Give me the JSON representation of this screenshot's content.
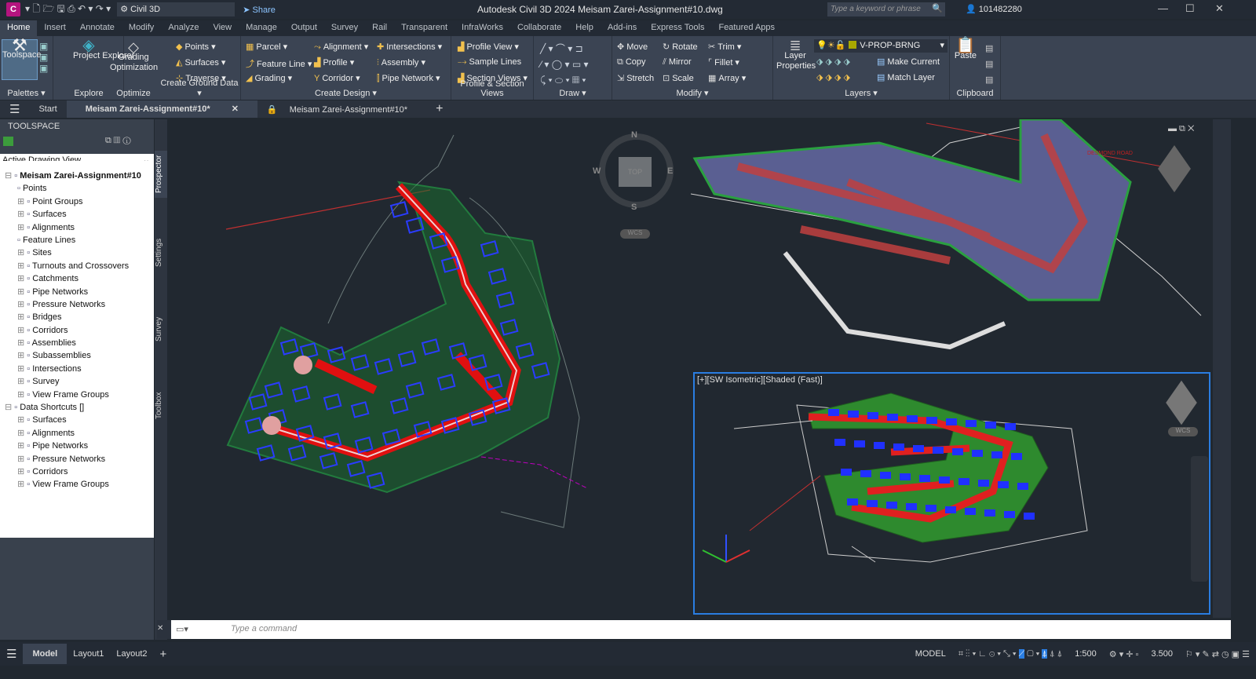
{
  "titlebar": {
    "app_letter": "C",
    "workspace": "Civil 3D",
    "share": "Share",
    "title": "Autodesk Civil 3D 2024   Meisam Zarei-Assignment#10.dwg",
    "search_placeholder": "Type a keyword or phrase",
    "user": "101482280"
  },
  "ribbon_tabs": [
    "Home",
    "Insert",
    "Annotate",
    "Modify",
    "Analyze",
    "View",
    "Manage",
    "Output",
    "Survey",
    "Rail",
    "Transparent",
    "InfraWorks",
    "Collaborate",
    "Help",
    "Add-ins",
    "Express Tools",
    "Featured Apps"
  ],
  "ribbon": {
    "palettes": {
      "toolspace": "Toolspace",
      "label": "Palettes ▾"
    },
    "explore": {
      "project_explorer": "Project Explorer",
      "label": "Explore"
    },
    "optimize": {
      "grading_optimization": "Grading Optimization",
      "label": "Optimize"
    },
    "ground": {
      "items": [
        "Points ▾",
        "Surfaces ▾",
        "Traverse ▾"
      ],
      "label": "Create Ground Data ▾"
    },
    "design": {
      "items": [
        "Parcel ▾",
        "Feature Line ▾",
        "Grading ▾",
        "Alignment ▾",
        "Profile ▾",
        "Corridor ▾",
        "Intersections ▾",
        "Assembly ▾",
        "Pipe Network ▾"
      ],
      "label": "Create Design ▾"
    },
    "profile": {
      "items": [
        "Profile View ▾",
        "Sample Lines",
        "Section Views ▾"
      ],
      "label": "Profile & Section Views"
    },
    "draw": {
      "label": "Draw ▾"
    },
    "modify": {
      "items": [
        "Move",
        "Copy",
        "Stretch",
        "Rotate",
        "Mirror",
        "Scale",
        "Trim ▾",
        "Fillet ▾",
        "Array ▾"
      ],
      "label": "Modify ▾"
    },
    "layers": {
      "layer_properties": "Layer Properties",
      "current_layer": "V-PROP-BRNG",
      "make_current": "Make Current",
      "match_layer": "Match Layer",
      "label": "Layers ▾",
      "layer_color": "#a8a800"
    },
    "clipboard": {
      "paste": "Paste",
      "label": "Clipboard"
    }
  },
  "doc_tabs": [
    "Start",
    "Meisam Zarei-Assignment#10*",
    "Meisam Zarei-Assignment#10*"
  ],
  "toolspace": {
    "title": "TOOLSPACE",
    "view": "Active Drawing View",
    "root": "Meisam Zarei-Assignment#10",
    "items": [
      "Points",
      "Point Groups",
      "Surfaces",
      "Alignments",
      "Feature Lines",
      "Sites",
      "Turnouts and Crossovers",
      "Catchments",
      "Pipe Networks",
      "Pressure Networks",
      "Bridges",
      "Corridors",
      "Assemblies",
      "Subassemblies",
      "Intersections",
      "Survey",
      "View Frame Groups"
    ],
    "shortcuts_root": "Data Shortcuts []",
    "shortcuts": [
      "Surfaces",
      "Alignments",
      "Pipe Networks",
      "Pressure Networks",
      "Corridors",
      "View Frame Groups"
    ],
    "side_tabs": [
      "Prospector",
      "Settings",
      "Survey",
      "Toolbox"
    ]
  },
  "viewports": {
    "compass": {
      "n": "N",
      "s": "S",
      "e": "E",
      "w": "W",
      "top": "TOP",
      "ucs": "WCS"
    },
    "bottom_label": "[+][SW Isometric][Shaded (Fast)]",
    "road_label": "DESMOND ROAD"
  },
  "command": {
    "placeholder": "Type a command"
  },
  "status": {
    "tabs": [
      "Model",
      "Layout1",
      "Layout2"
    ],
    "mode": "MODEL",
    "scale": "1:500",
    "value": "3.500"
  }
}
